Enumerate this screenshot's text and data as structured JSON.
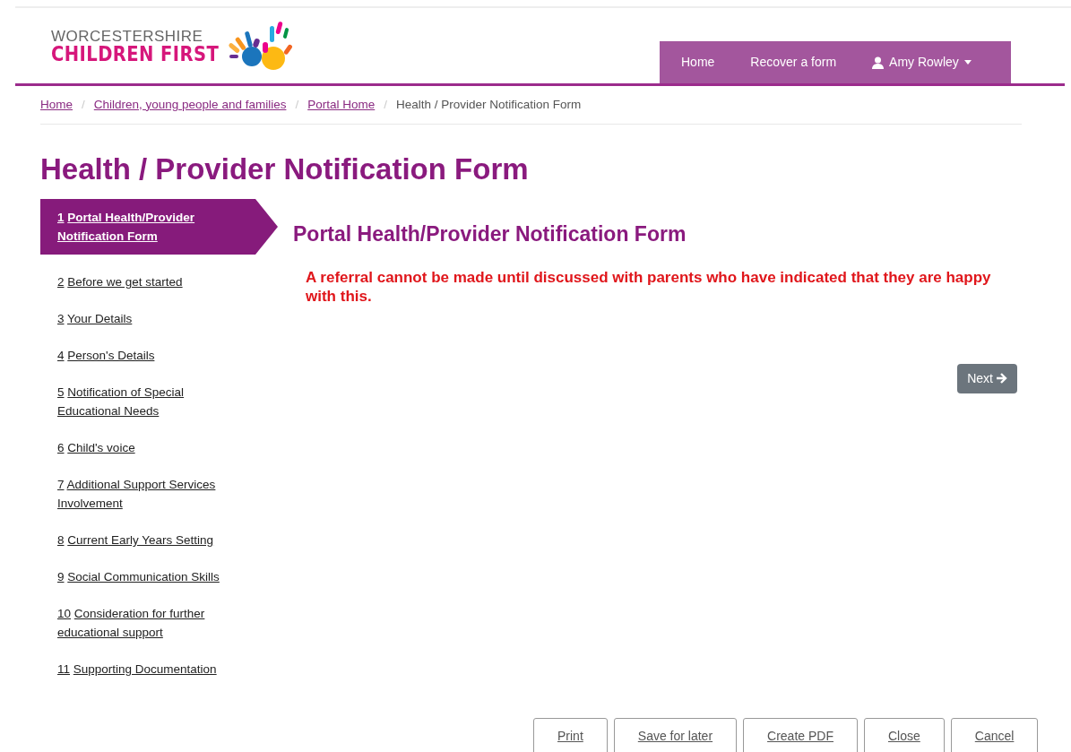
{
  "logo": {
    "line1": "WORCESTERSHIRE",
    "line2": "CHILDREN FIRST"
  },
  "nav": [
    {
      "label": "Home",
      "kind": "link"
    },
    {
      "label": "Recover a form",
      "kind": "link"
    },
    {
      "label": "Amy Rowley",
      "kind": "user"
    }
  ],
  "breadcrumb_separator": "/",
  "breadcrumb": [
    {
      "label": "Home",
      "current": false
    },
    {
      "label": "Children, young people and families",
      "current": false
    },
    {
      "label": "Portal Home",
      "current": false
    },
    {
      "label": "Health / Provider Notification Form",
      "current": true
    }
  ],
  "page_title": "Health / Provider Notification Form",
  "steps": [
    {
      "number": "1",
      "label": "Portal Health/Provider Notification Form",
      "selected": true
    },
    {
      "number": "2",
      "label": "Before we get started",
      "selected": false
    },
    {
      "number": "3",
      "label": "Your Details",
      "selected": false
    },
    {
      "number": "4",
      "label": "Person's Details",
      "selected": false
    },
    {
      "number": "5",
      "label": "Notification of Special Educational Needs",
      "selected": false
    },
    {
      "number": "6",
      "label": "Child's voice",
      "selected": false
    },
    {
      "number": "7",
      "label": "Additional Support Services Involvement",
      "selected": false
    },
    {
      "number": "8",
      "label": "Current Early Years Setting",
      "selected": false
    },
    {
      "number": "9",
      "label": "Social Communication Skills",
      "selected": false
    },
    {
      "number": "10",
      "label": "Consideration for further educational support",
      "selected": false
    },
    {
      "number": "11",
      "label": "Supporting Documentation",
      "selected": false
    }
  ],
  "section_title": "Portal Health/Provider Notification Form",
  "warning": "A referral cannot be made until discussed with parents who have indicated that they are happy with this.",
  "next_button": "Next",
  "actions": [
    "Print",
    "Save for later",
    "Create PDF",
    "Close",
    "Cancel"
  ]
}
